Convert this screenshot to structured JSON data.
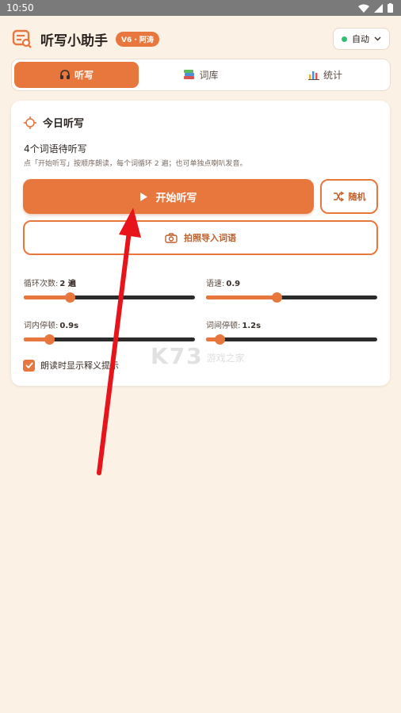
{
  "status_bar": {
    "time": "10:50"
  },
  "header": {
    "title": "听写小助手",
    "version_badge": "V6 · 阿涛",
    "mode_select": {
      "value": "自动",
      "status_color": "#2fbf71"
    }
  },
  "tabs": [
    {
      "label": "听写",
      "icon": "headphones-icon",
      "active": true
    },
    {
      "label": "词库",
      "icon": "books-icon",
      "active": false
    },
    {
      "label": "统计",
      "icon": "bar-chart-icon",
      "active": false
    }
  ],
  "card": {
    "title": "今日听写",
    "pending_text": "4个词语待听写",
    "hint": "点「开始听写」按顺序朗读，每个词循环 2 遍；也可单独点喇叭发音。",
    "start_button": "开始听写",
    "random_button": "随机",
    "import_button": "拍照导入词语",
    "sliders": [
      {
        "label": "循环次数:",
        "value": "2 遍",
        "level": 0.27
      },
      {
        "label": "语速:",
        "value": "0.9",
        "level": 0.41
      },
      {
        "label": "词内停顿:",
        "value": "0.9s",
        "level": 0.15
      },
      {
        "label": "词间停顿:",
        "value": "1.2s",
        "level": 0.08
      }
    ],
    "checkbox": {
      "label": "朗读时显示释义提示",
      "checked": true
    }
  },
  "watermark": {
    "big": "K73",
    "small": "游戏之家"
  },
  "colors": {
    "accent": "#e8773e",
    "background": "#fbf1e5",
    "annotation_arrow": "#e8141c"
  }
}
